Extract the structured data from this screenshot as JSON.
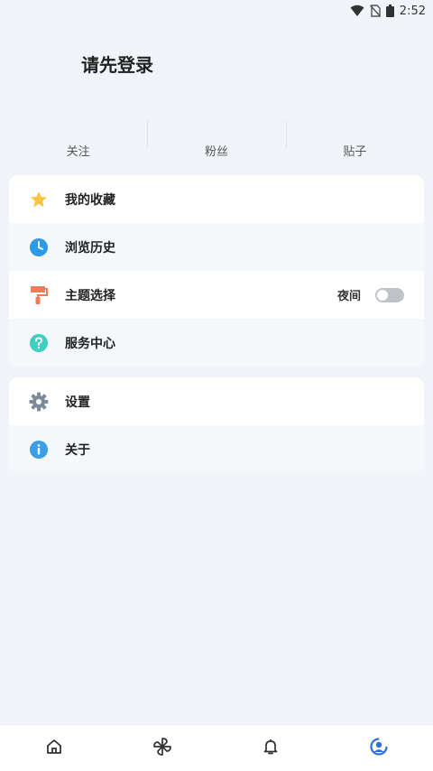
{
  "status_bar": {
    "time": "2:52",
    "icons": [
      "wifi-icon",
      "no-sim-icon",
      "battery-icon"
    ]
  },
  "header": {
    "login_prompt": "请先登录"
  },
  "stats": [
    {
      "label": "关注"
    },
    {
      "label": "粉丝"
    },
    {
      "label": "贴子"
    }
  ],
  "menu_group_1": [
    {
      "label": "我的收藏",
      "icon": "star-icon",
      "color": "#f6c343"
    },
    {
      "label": "浏览历史",
      "icon": "clock-icon",
      "color": "#2b9be8"
    },
    {
      "label": "主题选择",
      "icon": "paint-roller-icon",
      "color": "#f07a5a",
      "right_text": "夜间",
      "toggle_on": false
    },
    {
      "label": "服务中心",
      "icon": "help-icon",
      "color": "#3fcfc0"
    }
  ],
  "menu_group_2": [
    {
      "label": "设置",
      "icon": "gear-icon",
      "color": "#7d8b99"
    },
    {
      "label": "关于",
      "icon": "info-icon",
      "color": "#3a9ee8"
    }
  ],
  "bottom_nav": [
    {
      "icon": "home-icon",
      "active": false
    },
    {
      "icon": "pinwheel-icon",
      "active": false
    },
    {
      "icon": "bell-icon",
      "active": false
    },
    {
      "icon": "profile-icon",
      "active": true,
      "color": "#2e6fd6"
    }
  ]
}
